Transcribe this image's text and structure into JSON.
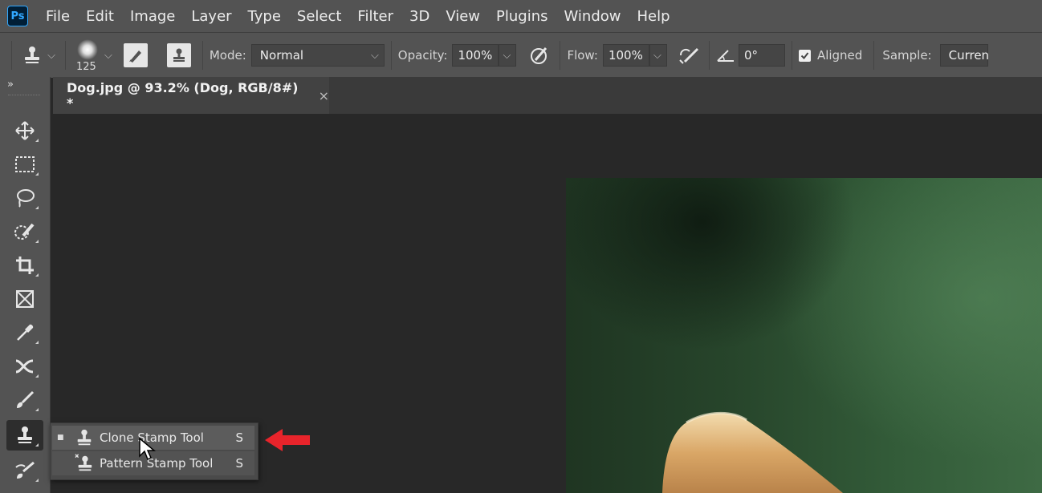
{
  "app": {
    "logo_text": "Ps"
  },
  "menubar": {
    "items": [
      "File",
      "Edit",
      "Image",
      "Layer",
      "Type",
      "Select",
      "Filter",
      "3D",
      "View",
      "Plugins",
      "Window",
      "Help"
    ]
  },
  "options_bar": {
    "brush_size": "125",
    "mode_label": "Mode:",
    "mode_value": "Normal",
    "opacity_label": "Opacity:",
    "opacity_value": "100%",
    "flow_label": "Flow:",
    "flow_value": "100%",
    "angle_value": "0°",
    "aligned_label": "Aligned",
    "aligned_checked": true,
    "sample_label": "Sample:",
    "sample_value": "Curren"
  },
  "toolbar": {
    "collapse_glyph": "»",
    "tools": [
      "move-icon",
      "marquee-icon",
      "lasso-icon",
      "quick-selection-icon",
      "crop-icon",
      "frame-icon",
      "eyedropper-icon",
      "healing-brush-icon",
      "brush-icon",
      "clone-stamp-icon",
      "history-brush-icon"
    ],
    "active_tool": "clone-stamp-icon"
  },
  "document_tab": {
    "title": "Dog.jpg @ 93.2% (Dog, RGB/8#) *",
    "close_glyph": "×"
  },
  "tool_flyout": {
    "items": [
      {
        "label": "Clone Stamp Tool",
        "shortcut": "S",
        "selected": true,
        "icon": "clone-stamp-icon"
      },
      {
        "label": "Pattern Stamp Tool",
        "shortcut": "S",
        "selected": false,
        "icon": "pattern-stamp-icon"
      }
    ]
  },
  "colors": {
    "ui_dark": "#535353",
    "canvas_bg": "#282828",
    "annotation_arrow": "#e8242b",
    "photo_green": "#2f5534"
  }
}
